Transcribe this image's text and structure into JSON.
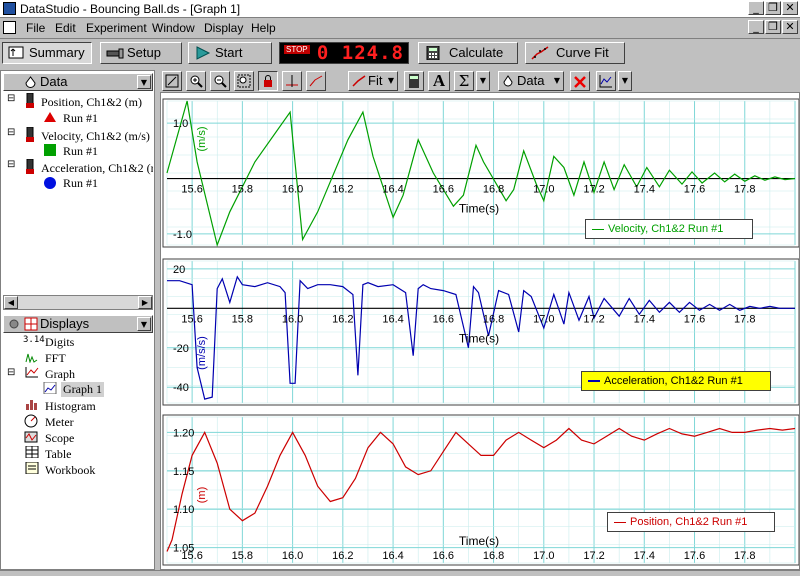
{
  "window": {
    "title": "DataStudio - Bouncing Ball.ds - [Graph 1]",
    "min": "_",
    "restore": "❐",
    "close": "✕"
  },
  "menu": [
    "File",
    "Edit",
    "Experiment",
    "Window",
    "Display",
    "Help"
  ],
  "toolbar": {
    "summary": "Summary",
    "setup": "Setup",
    "start": "Start",
    "stop_label": "STOP",
    "clock": "0 124.8",
    "calculate": "Calculate",
    "curve_fit": "Curve Fit"
  },
  "data_pane": {
    "header": "Data",
    "items": [
      {
        "label": "Position, Ch1&2 (m)",
        "run": "Run #1",
        "marker": "triangle",
        "color": "#cc0000"
      },
      {
        "label": "Velocity, Ch1&2 (m/s)",
        "run": "Run #1",
        "marker": "square",
        "color": "#00a000"
      },
      {
        "label": "Acceleration, Ch1&2 (m/s/s)",
        "run": "Run #1",
        "marker": "circle",
        "color": "#0000cc"
      }
    ]
  },
  "displays_pane": {
    "header": "Displays",
    "items": [
      "Digits",
      "FFT",
      "Graph",
      "Graph 1",
      "Histogram",
      "Meter",
      "Scope",
      "Table",
      "Workbook"
    ]
  },
  "graph_toolbar": {
    "fit": "Fit",
    "data": "Data"
  },
  "colors": {
    "velocity": "#00a000",
    "acceleration": "#0000b0",
    "position": "#cc0000",
    "grid": "#7fd7d7"
  },
  "graphs": {
    "velocity": {
      "unit": "(m/s)",
      "x_label": "Time(s)",
      "legend": "Velocity, Ch1&2 Run #1"
    },
    "acceleration": {
      "unit": "(m/s/s)",
      "x_label": "Time(s)",
      "legend": "Acceleration, Ch1&2 Run #1"
    },
    "position": {
      "unit": "(m)",
      "x_label": "Time(s)",
      "legend": "Position, Ch1&2 Run #1"
    }
  },
  "chart_data": [
    {
      "type": "line",
      "series": [
        {
          "name": "Velocity, Ch1&2 Run #1"
        }
      ],
      "xlabel": "Time(s)",
      "ylabel": "(m/s)",
      "xlim": [
        15.5,
        18.0
      ],
      "ylim": [
        -1.2,
        1.4
      ],
      "x_ticks": [
        15.6,
        15.8,
        16.0,
        16.2,
        16.4,
        16.6,
        16.8,
        17.0,
        17.2,
        17.4,
        17.6,
        17.8
      ],
      "y_ticks": [
        1.0,
        -1.0
      ],
      "x": [
        15.5,
        15.58,
        15.62,
        15.7,
        15.75,
        15.85,
        15.99,
        16.04,
        16.1,
        16.22,
        16.28,
        16.32,
        16.4,
        16.44,
        16.5,
        16.56,
        16.64,
        16.68,
        16.73,
        16.76,
        16.85,
        16.88,
        16.92,
        16.97,
        17.0,
        17.04,
        17.08,
        17.12,
        17.16,
        17.2,
        17.24,
        17.28,
        17.32,
        17.37,
        17.41,
        17.46,
        17.5,
        17.55,
        17.59,
        17.63,
        17.68,
        17.72,
        17.76,
        17.8,
        17.84,
        17.88,
        17.92,
        17.96,
        18.0
      ],
      "y": [
        0.1,
        1.4,
        0.3,
        -1.2,
        -0.6,
        0.3,
        1.2,
        -1.1,
        -0.6,
        0.7,
        1.2,
        0.4,
        -0.7,
        -0.3,
        0.7,
        0.1,
        -0.5,
        -0.3,
        0.6,
        0.3,
        -0.4,
        -0.2,
        0.5,
        -0.1,
        -0.4,
        0.4,
        0.2,
        -0.3,
        0.3,
        -0.25,
        0.3,
        -0.2,
        0.25,
        -0.15,
        0.2,
        -0.15,
        0.15,
        -0.1,
        0.12,
        -0.08,
        0.1,
        -0.06,
        0.08,
        -0.05,
        0.05,
        -0.03,
        0.03,
        -0.02,
        0.0
      ]
    },
    {
      "type": "line",
      "series": [
        {
          "name": "Acceleration, Ch1&2 Run #1"
        }
      ],
      "xlabel": "Time(s)",
      "ylabel": "(m/s/s)",
      "xlim": [
        15.5,
        18.0
      ],
      "ylim": [
        -48,
        24
      ],
      "x_ticks": [
        15.6,
        15.8,
        16.0,
        16.2,
        16.4,
        16.6,
        16.8,
        17.0,
        17.2,
        17.4,
        17.6,
        17.8
      ],
      "y_ticks": [
        20,
        -20,
        -40
      ],
      "x": [
        15.5,
        15.55,
        15.6,
        15.62,
        15.65,
        15.68,
        15.7,
        15.72,
        15.75,
        15.78,
        15.8,
        15.85,
        15.9,
        15.95,
        15.97,
        15.99,
        16.01,
        16.03,
        16.06,
        16.1,
        16.15,
        16.2,
        16.24,
        16.26,
        16.28,
        16.3,
        16.34,
        16.4,
        16.45,
        16.48,
        16.5,
        16.52,
        16.55,
        16.6,
        16.65,
        16.7,
        16.72,
        16.74,
        16.78,
        16.82,
        16.86,
        16.9,
        16.92,
        16.95,
        17.0,
        17.04,
        17.08,
        17.1,
        17.14,
        17.18,
        17.2,
        17.24,
        17.3,
        17.34,
        17.38,
        17.42,
        17.46,
        17.5,
        17.54,
        17.58,
        17.62,
        17.66,
        17.7,
        17.74,
        17.78,
        17.82,
        17.86,
        17.9,
        17.94,
        18.0
      ],
      "y": [
        14,
        14,
        12,
        -30,
        -46,
        -45,
        10,
        15,
        3,
        16,
        12,
        11,
        13,
        11,
        8,
        -38,
        -38,
        14,
        10,
        12,
        12,
        11,
        7,
        -34,
        12,
        13,
        11,
        12,
        8,
        -24,
        10,
        12,
        10,
        9,
        7,
        -20,
        11,
        8,
        -14,
        9,
        7,
        -12,
        9,
        6,
        -10,
        7,
        -8,
        8,
        -6,
        6,
        -5,
        5,
        -4,
        5,
        -3,
        4,
        -2,
        3,
        -2,
        3,
        -1,
        2,
        -1,
        2,
        -1,
        1,
        0,
        1,
        0,
        0
      ]
    },
    {
      "type": "line",
      "series": [
        {
          "name": "Position, Ch1&2 Run #1"
        }
      ],
      "xlabel": "Time(s)",
      "ylabel": "(m)",
      "xlim": [
        15.5,
        18.0
      ],
      "ylim": [
        1.03,
        1.22
      ],
      "x_ticks": [
        15.6,
        15.8,
        16.0,
        16.2,
        16.4,
        16.6,
        16.8,
        17.0,
        17.2,
        17.4,
        17.6,
        17.8
      ],
      "y_ticks": [
        1.2,
        1.15,
        1.1,
        1.05
      ],
      "x": [
        15.5,
        15.52,
        15.56,
        15.6,
        15.65,
        15.7,
        15.75,
        15.8,
        15.85,
        15.9,
        15.95,
        16.0,
        16.05,
        16.1,
        16.15,
        16.2,
        16.25,
        16.3,
        16.35,
        16.4,
        16.45,
        16.5,
        16.55,
        16.6,
        16.65,
        16.7,
        16.75,
        16.8,
        16.85,
        16.9,
        16.95,
        17.0,
        17.05,
        17.1,
        17.15,
        17.2,
        17.25,
        17.3,
        17.35,
        17.4,
        17.45,
        17.5,
        17.55,
        17.6,
        17.65,
        17.7,
        17.75,
        17.8,
        17.85,
        17.9,
        17.95,
        18.0
      ],
      "y": [
        1.045,
        1.06,
        1.12,
        1.17,
        1.2,
        1.16,
        1.1,
        1.085,
        1.095,
        1.13,
        1.17,
        1.2,
        1.17,
        1.13,
        1.11,
        1.115,
        1.14,
        1.18,
        1.2,
        1.185,
        1.155,
        1.145,
        1.15,
        1.175,
        1.2,
        1.185,
        1.17,
        1.17,
        1.19,
        1.2,
        1.19,
        1.18,
        1.19,
        1.205,
        1.19,
        1.185,
        1.195,
        1.205,
        1.195,
        1.19,
        1.198,
        1.205,
        1.198,
        1.195,
        1.2,
        1.205,
        1.2,
        1.2,
        1.203,
        1.205,
        1.203,
        1.205
      ]
    }
  ]
}
